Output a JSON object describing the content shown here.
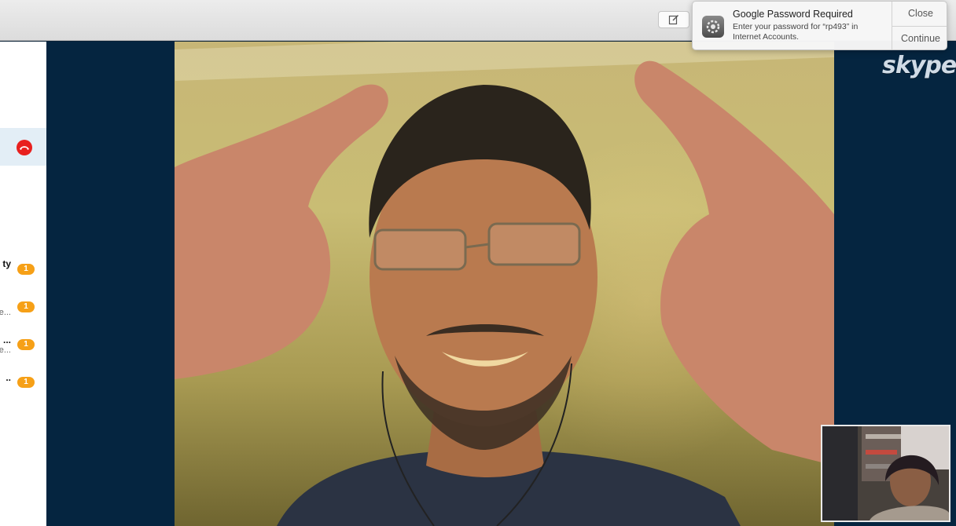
{
  "window": {
    "compose_icon": "compose-icon"
  },
  "sidebar": {
    "active_call_icon": "hang-up-icon",
    "items": [
      {
        "name": "ty",
        "subtitle": "",
        "badge": "1"
      },
      {
        "name": "",
        "subtitle": "e...",
        "badge": "1"
      },
      {
        "name": "...",
        "subtitle": "e...",
        "badge": "1"
      },
      {
        "name": "..",
        "subtitle": "",
        "badge": "1"
      }
    ]
  },
  "call": {
    "brand": "skype",
    "main_video": "remote-participant-video",
    "self_view": "local-camera-preview"
  },
  "notification": {
    "icon": "system-preferences-icon",
    "title": "Google Password Required",
    "body": "Enter your password for “rp493” in Internet Accounts.",
    "close_label": "Close",
    "continue_label": "Continue"
  },
  "colors": {
    "stage_bg": "#052540",
    "badge": "#f6a017",
    "hangup": "#e8201e",
    "active_row": "#e3eef6"
  }
}
